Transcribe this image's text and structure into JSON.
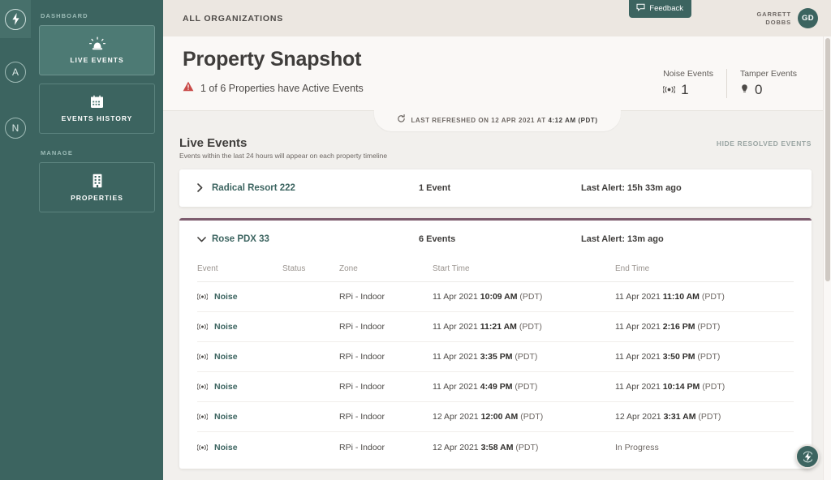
{
  "rail": {
    "items": [
      {
        "name": "bolt",
        "glyph": "⚡",
        "active": true
      },
      {
        "name": "org-a",
        "glyph": "A",
        "active": false
      },
      {
        "name": "org-n",
        "glyph": "N",
        "active": false
      }
    ]
  },
  "sidebar": {
    "groups": [
      {
        "label": "Dashboard"
      },
      {
        "label": "Manage"
      }
    ],
    "items": [
      {
        "label": "Live Events",
        "icon": "siren-icon",
        "active": true
      },
      {
        "label": "Events History",
        "icon": "calendar-icon",
        "active": false
      },
      {
        "label": "Properties",
        "icon": "building-icon",
        "active": false
      }
    ]
  },
  "topbar": {
    "breadcrumb": "All Organizations",
    "feedback_label": "Feedback",
    "user_name": "Garrett Dobbs",
    "user_initials": "GD"
  },
  "header": {
    "title": "Property Snapshot",
    "alert_text": "1 of 6 Properties have Active Events",
    "stats": [
      {
        "label": "Noise Events",
        "value": "1",
        "icon": "noise-icon"
      },
      {
        "label": "Tamper Events",
        "value": "0",
        "icon": "tamper-icon"
      }
    ]
  },
  "refresh": {
    "prefix": "Last refreshed on 12 Apr 2021 at ",
    "time": "4:12 AM (PDT)"
  },
  "live_events": {
    "title": "Live Events",
    "subtitle": "Events within the last 24 hours will appear on each property timeline",
    "hide_resolved_label": "Hide Resolved Events",
    "properties": [
      {
        "name": "Radical Resort 222",
        "count": "1 Event",
        "last_alert": "Last Alert: 15h 33m ago",
        "expanded": false
      },
      {
        "name": "Rose PDX 33",
        "count": "6 Events",
        "last_alert": "Last Alert: 13m ago",
        "expanded": true
      }
    ],
    "table": {
      "columns": [
        "Event",
        "Status",
        "Zone",
        "Start Time",
        "End Time"
      ],
      "rows": [
        {
          "event": "Noise",
          "status": "",
          "zone": "RPi - Indoor",
          "start_date": "11 Apr 2021 ",
          "start_time": "10:09 AM",
          "start_tz": " (PDT)",
          "end_date": "11 Apr 2021 ",
          "end_time": "11:10 AM",
          "end_tz": " (PDT)"
        },
        {
          "event": "Noise",
          "status": "",
          "zone": "RPi - Indoor",
          "start_date": "11 Apr 2021 ",
          "start_time": "11:21 AM",
          "start_tz": " (PDT)",
          "end_date": "11 Apr 2021 ",
          "end_time": "2:16 PM",
          "end_tz": " (PDT)"
        },
        {
          "event": "Noise",
          "status": "",
          "zone": "RPi - Indoor",
          "start_date": "11 Apr 2021 ",
          "start_time": "3:35 PM",
          "start_tz": " (PDT)",
          "end_date": "11 Apr 2021 ",
          "end_time": "3:50 PM",
          "end_tz": " (PDT)"
        },
        {
          "event": "Noise",
          "status": "",
          "zone": "RPi - Indoor",
          "start_date": "11 Apr 2021 ",
          "start_time": "4:49 PM",
          "start_tz": " (PDT)",
          "end_date": "11 Apr 2021 ",
          "end_time": "10:14 PM",
          "end_tz": " (PDT)"
        },
        {
          "event": "Noise",
          "status": "",
          "zone": "RPi - Indoor",
          "start_date": "12 Apr 2021 ",
          "start_time": "12:00 AM",
          "start_tz": " (PDT)",
          "end_date": "12 Apr 2021 ",
          "end_time": "3:31 AM",
          "end_tz": " (PDT)"
        },
        {
          "event": "Noise",
          "status": "",
          "zone": "RPi - Indoor",
          "start_date": "12 Apr 2021 ",
          "start_time": "3:58 AM",
          "start_tz": " (PDT)",
          "end_date": "In Progress",
          "end_time": "",
          "end_tz": ""
        }
      ]
    }
  },
  "colors": {
    "brand_green": "#3c6460",
    "accent_purple": "#7d5c6e",
    "alert_red": "#c94a48",
    "topbar_beige": "#ece7e1",
    "card_white": "#ffffff"
  }
}
